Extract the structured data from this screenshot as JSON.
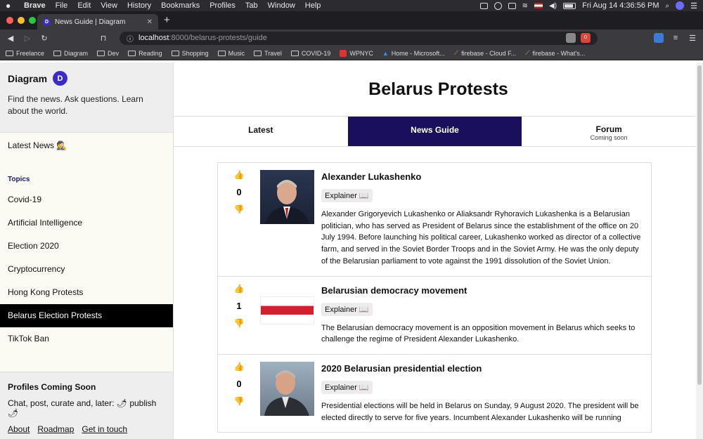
{
  "menubar": {
    "app": "Brave",
    "items": [
      "File",
      "Edit",
      "View",
      "History",
      "Bookmarks",
      "Profiles",
      "Tab",
      "Window",
      "Help"
    ],
    "clock": "Fri Aug 14  4:36:56 PM"
  },
  "browser": {
    "tab_title": "News Guide | Diagram",
    "tab_favicon": "D",
    "url_host": "localhost",
    "url_path": ":8000/belarus-protests/guide",
    "shields_count": "0"
  },
  "bookmarks": [
    "Freelance",
    "Diagram",
    "Dev",
    "Reading",
    "Shopping",
    "Music",
    "Travel",
    "COVID-19",
    "WPNYC",
    "Home - Microsoft...",
    "firebase - Cloud F...",
    "firebase - What's..."
  ],
  "sidebar": {
    "brand": "Diagram",
    "logo": "D",
    "tagline": "Find the news. Ask questions. Learn about the world.",
    "latest": "Latest News 🕵",
    "topics_label": "Topics",
    "topics": [
      "Covid-19",
      "Artificial Intelligence",
      "Election 2020",
      "Cryptocurrency",
      "Hong Kong Protests",
      "Belarus Election Protests",
      "TikTok Ban"
    ],
    "active_topic": "Belarus Election Protests",
    "footer": {
      "heading": "Profiles Coming Soon",
      "text": "Chat, post, curate and, later: 🌶 publish 🌶",
      "links": [
        "About",
        "Roadmap",
        "Get in touch"
      ]
    }
  },
  "main": {
    "title": "Belarus Protests",
    "tabs": [
      {
        "label": "Latest",
        "sub": ""
      },
      {
        "label": "News Guide",
        "sub": ""
      },
      {
        "label": "Forum",
        "sub": "Coming soon"
      }
    ],
    "cards": [
      {
        "votes": "0",
        "title": "Alexander Lukashenko",
        "badge": "Explainer 📖",
        "text": "Alexander Grigoryevich Lukashenko or Aliaksandr Ryhoravich Lukashenka is a Belarusian politician, who has served as President of Belarus since the establishment of the office on 20 July 1994. Before launching his political career, Lukashenko worked as director of a collective farm, and served in the Soviet Border Troops and in the Soviet Army. He was the only deputy of the Belarusian parliament to vote against the 1991 dissolution of the Soviet Union."
      },
      {
        "votes": "1",
        "title": "Belarusian democracy movement",
        "badge": "Explainer 📖",
        "text": "The Belarusian democracy movement is an opposition movement in Belarus which seeks to challenge the regime of President Alexander Lukashenko."
      },
      {
        "votes": "0",
        "title": "2020 Belarusian presidential election",
        "badge": "Explainer 📖",
        "text": "Presidential elections will be held in Belarus on Sunday, 9 August 2020. The president will be elected directly to serve for five years. Incumbent Alexander Lukashenko will be running"
      }
    ]
  },
  "colors": {
    "accent": "#1a0f5c",
    "brand": "#3b2cc9"
  }
}
